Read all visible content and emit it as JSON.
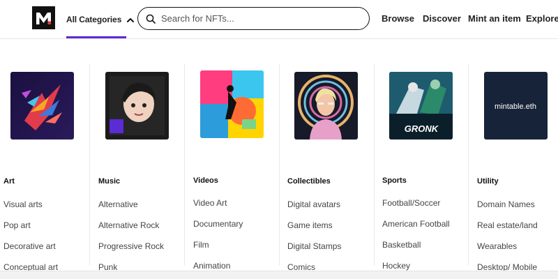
{
  "header": {
    "logo_icon": "mintable-m-logo",
    "categories_label": "All Categories",
    "search": {
      "placeholder": "Search for NFTs..."
    },
    "nav": [
      "Browse",
      "Discover",
      "Mint an item",
      "Explore"
    ]
  },
  "menu": {
    "columns": [
      {
        "title": "Art",
        "items": [
          "Visual arts",
          "Pop art",
          "Decorative art",
          "Conceptual art"
        ]
      },
      {
        "title": "Music",
        "items": [
          "Alternative",
          "Alternative Rock",
          "Progressive Rock",
          "Punk"
        ]
      },
      {
        "title": "Videos",
        "items": [
          "Video Art",
          "Documentary",
          "Film",
          "Animation"
        ]
      },
      {
        "title": "Collectibles",
        "items": [
          "Digital avatars",
          "Game items",
          "Digital Stamps",
          "Comics"
        ]
      },
      {
        "title": "Sports",
        "items": [
          "Football/Soccer",
          "American Football",
          "Basketball",
          "Hockey"
        ]
      },
      {
        "title": "Utility",
        "items": [
          "Domain Names",
          "Real estate/land",
          "Wearables",
          "Desktop/ Mobile"
        ]
      }
    ],
    "thumb_texts": {
      "sports_caption": "GRONK",
      "utility_caption": "mintable.eth"
    }
  },
  "colors": {
    "accent": "#5b2bd6",
    "logo_bg": "#111111",
    "logo_red": "#e53935"
  }
}
